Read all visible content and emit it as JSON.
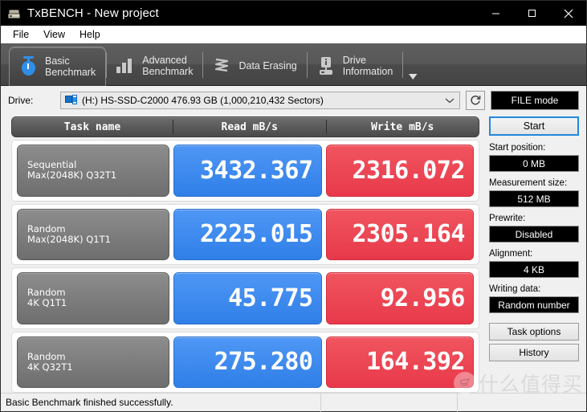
{
  "window": {
    "title": "TxBENCH - New project",
    "icon": "drive-icon",
    "controls": {
      "minimize": "minimize-icon",
      "maximize": "maximize-icon",
      "close": "close-icon"
    }
  },
  "menubar": {
    "items": [
      "File",
      "View",
      "Help"
    ]
  },
  "tabs": [
    {
      "line1": "Basic",
      "line2": "Benchmark",
      "icon": "stopwatch-icon",
      "active": true
    },
    {
      "line1": "Advanced",
      "line2": "Benchmark",
      "icon": "bar-chart-icon",
      "active": false
    },
    {
      "line1": "Data Erasing",
      "line2": "",
      "icon": "shredder-icon",
      "active": false
    },
    {
      "line1": "Drive",
      "line2": "Information",
      "icon": "drive-info-icon",
      "active": false
    }
  ],
  "tabs_overflow": "chevron-down-icon",
  "drivebar": {
    "label": "Drive:",
    "selected": "(H:) HS-SSD-C2000  476.93 GB (1,000,210,432 Sectors)",
    "caret": "chevron-down-icon",
    "refresh": "refresh-icon",
    "file_mode": "FILE mode"
  },
  "table": {
    "headers": {
      "name": "Task name",
      "read": "Read mB/s",
      "write": "Write mB/s"
    },
    "rows": [
      {
        "name1": "Sequential",
        "name2": "Max(2048K) Q32T1",
        "read": "3432.367",
        "write": "2316.072"
      },
      {
        "name1": "Random",
        "name2": "Max(2048K) Q1T1",
        "read": "2225.015",
        "write": "2305.164"
      },
      {
        "name1": "Random",
        "name2": "4K Q1T1",
        "read": "45.775",
        "write": "92.956"
      },
      {
        "name1": "Random",
        "name2": "4K Q32T1",
        "read": "275.280",
        "write": "164.392"
      }
    ]
  },
  "panel": {
    "start": "Start",
    "fields": [
      {
        "label": "Start position:",
        "value": "0 MB"
      },
      {
        "label": "Measurement size:",
        "value": "512 MB"
      },
      {
        "label": "Prewrite:",
        "value": "Disabled"
      },
      {
        "label": "Alignment:",
        "value": "4 KB"
      },
      {
        "label": "Writing data:",
        "value": "Random number"
      }
    ],
    "task_options": "Task options",
    "history": "History"
  },
  "statusbar": {
    "message": "Basic Benchmark finished successfully.",
    "segment2": "",
    "segment3": ""
  },
  "watermark": {
    "text": "什么值得买"
  },
  "colors": {
    "read": "#3d8bf2",
    "write": "#ee4a55",
    "accent": "#2288dd",
    "tabbar": "#555555"
  }
}
